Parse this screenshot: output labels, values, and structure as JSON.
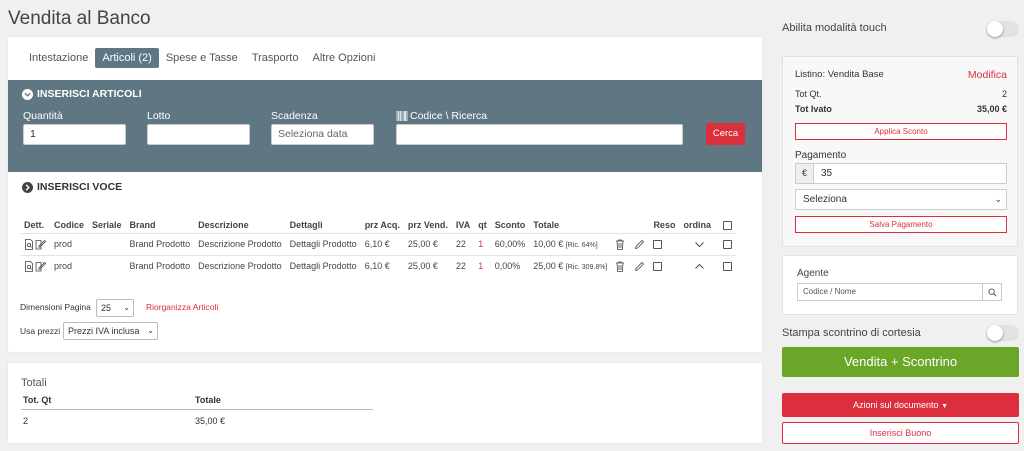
{
  "page_title": "Vendita al Banco",
  "tabs": [
    {
      "label": "Intestazione",
      "active": false
    },
    {
      "label": "Articoli (2)",
      "active": true
    },
    {
      "label": "Spese e Tasse",
      "active": false
    },
    {
      "label": "Trasporto",
      "active": false
    },
    {
      "label": "Altre Opzioni",
      "active": false
    }
  ],
  "inserisci_articoli": {
    "title": "INSERISCI ARTICOLI",
    "quantita_label": "Quantità",
    "quantita_value": "1",
    "lotto_label": "Lotto",
    "lotto_value": "",
    "scadenza_label": "Scadenza",
    "scadenza_placeholder": "Seleziona data",
    "codice_label": "Codice \\ Ricerca",
    "codice_value": "",
    "cerca_label": "Cerca"
  },
  "inserisci_voce": {
    "title": "INSERISCI VOCE"
  },
  "table": {
    "headers": [
      "Dett.",
      "Codice",
      "Seriale",
      "Brand",
      "Descrizione",
      "Dettagli",
      "prz Acq.",
      "prz Vend.",
      "IVA",
      "qt",
      "Sconto",
      "Totale",
      "",
      "",
      "Reso",
      "ordina",
      ""
    ],
    "rows": [
      {
        "codice": "prod",
        "seriale": "",
        "brand": "Brand Prodotto",
        "descrizione": "Descrizione Prodotto",
        "dettagli": "Dettagli Prodotto",
        "prz_acq": "6,10 €",
        "prz_vend": "25,00 €",
        "iva": "22",
        "qt": "1",
        "sconto": "60,00%",
        "totale": "10,00 €",
        "ric": "[Ric. 64%]",
        "ordina": "down"
      },
      {
        "codice": "prod",
        "seriale": "",
        "brand": "Brand Prodotto",
        "descrizione": "Descrizione Prodotto",
        "dettagli": "Dettagli Prodotto",
        "prz_acq": "6,10 €",
        "prz_vend": "25,00 €",
        "iva": "22",
        "qt": "1",
        "sconto": "0,00%",
        "totale": "25,00 €",
        "ric": "[Ric. 309.8%]",
        "ordina": "up"
      }
    ]
  },
  "pagination": {
    "label": "Dimensioni Pagina",
    "value": "25",
    "riorganizza_label": "Riorganizza Articoli",
    "usa_prezzi_label": "Usa prezzi",
    "usa_prezzi_value": "Prezzi IVA inclusa"
  },
  "totali": {
    "title": "Totali",
    "tot_qt_label": "Tot. Qt",
    "totale_label": "Totale",
    "tot_qt_value": "2",
    "totale_value": "35,00 €"
  },
  "sidebar": {
    "touch_label": "Abilita modalità touch",
    "touch_on": false,
    "listino_label": "Listino: Vendita Base",
    "modifica_label": "Modifica",
    "tot_qt_label": "Tot Qt.",
    "tot_qt_value": "2",
    "tot_ivato_label": "Tot Ivato",
    "tot_ivato_value": "35,00 €",
    "applica_sconto_label": "Applica Sconto",
    "pagamento_label": "Pagamento",
    "currency_symbol": "€",
    "pagamento_value": "35",
    "seleziona_label": "Seleziona",
    "salva_pagamento_label": "Salva Pagamento",
    "agente_label": "Agente",
    "agente_placeholder": "Codice / Nome",
    "stampa_label": "Stampa scontrino di cortesia",
    "stampa_on": false,
    "vendita_label": "Vendita + Scontrino",
    "azioni_label": "Azioni sul documento",
    "inserisci_buono_label": "Inserisci Buono"
  },
  "colors": {
    "section_bg": "#5e7782",
    "accent_red": "#d9303c",
    "accent_green": "#6aa628"
  }
}
